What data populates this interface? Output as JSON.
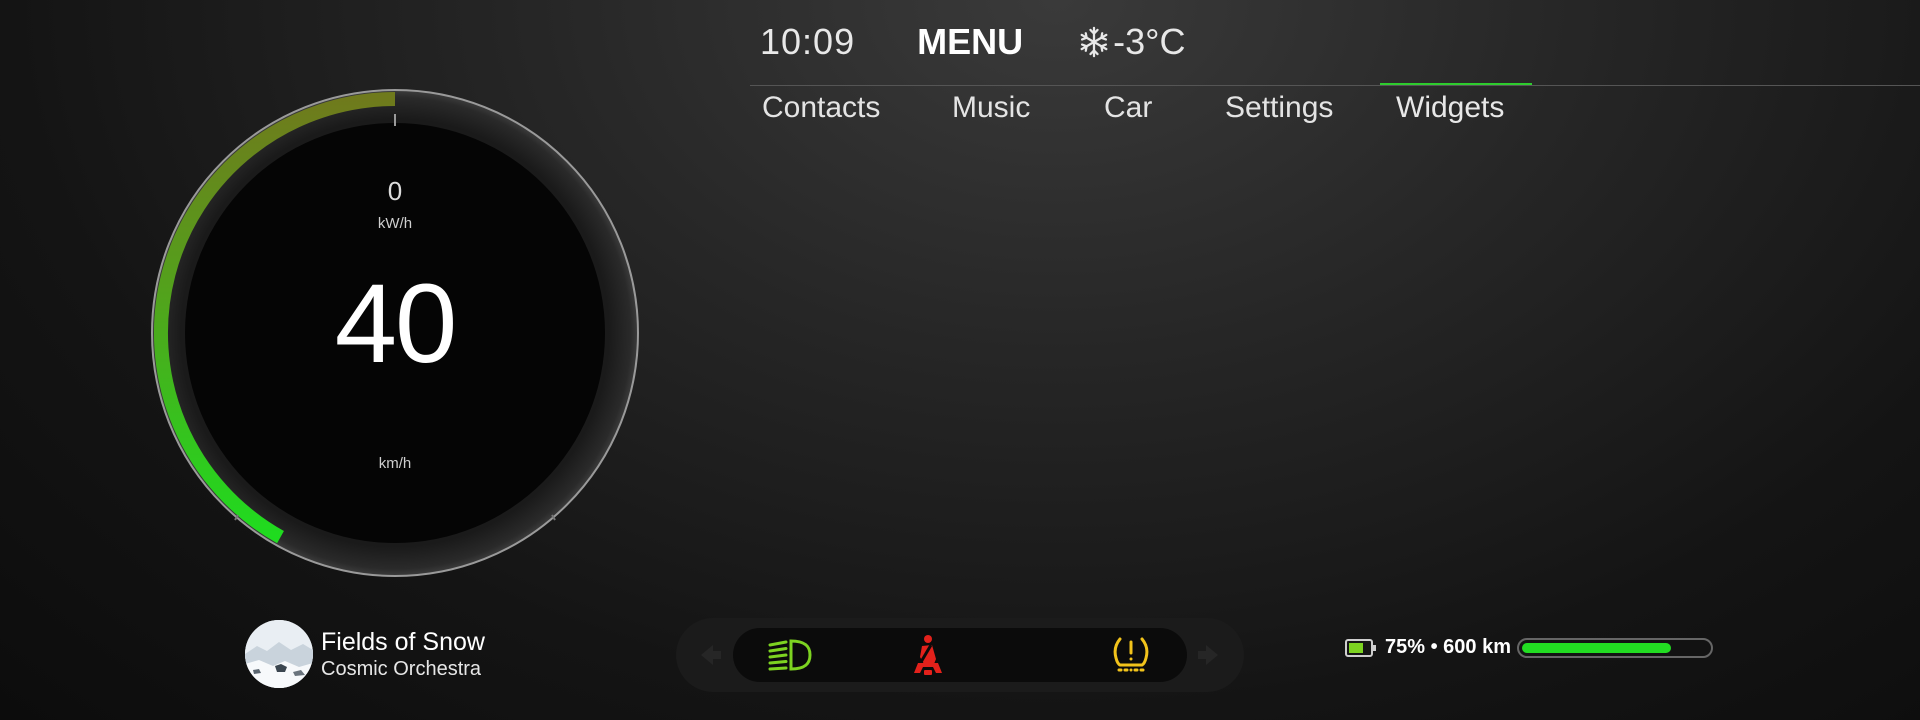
{
  "header": {
    "time": "10:09",
    "title": "MENU",
    "weather_icon": "snowflake-icon",
    "temperature": "-3°C"
  },
  "tabs": [
    {
      "label": "Contacts",
      "active": false
    },
    {
      "label": "Music",
      "active": false
    },
    {
      "label": "Car",
      "active": false
    },
    {
      "label": "Settings",
      "active": false
    },
    {
      "label": "Widgets",
      "active": true
    }
  ],
  "gauge": {
    "power_value": "0",
    "power_unit": "kW/h",
    "speed_value": "40",
    "speed_unit": "km/h",
    "arc_colors": [
      "#6f7a1c",
      "#1fdc1f"
    ]
  },
  "now_playing": {
    "title": "Fields of Snow",
    "artist": "Cosmic Orchestra",
    "album_art": "snowy-landscape"
  },
  "warnings": {
    "prev_icon": "chevron-left-icon",
    "next_icon": "chevron-right-icon",
    "items": [
      {
        "icon": "headlight-icon",
        "color": "#7dd321"
      },
      {
        "icon": "seatbelt-icon",
        "color": "#e3211b"
      },
      {
        "icon": "tire-pressure-icon",
        "color": "#f2c31b"
      }
    ]
  },
  "battery": {
    "percent": 75,
    "range_text": "75% • 600 km",
    "bar_fill": 0.8,
    "fill_color": "#22dd22"
  },
  "colors": {
    "accent": "#2ecc2e",
    "background": "#1a1a1a"
  }
}
